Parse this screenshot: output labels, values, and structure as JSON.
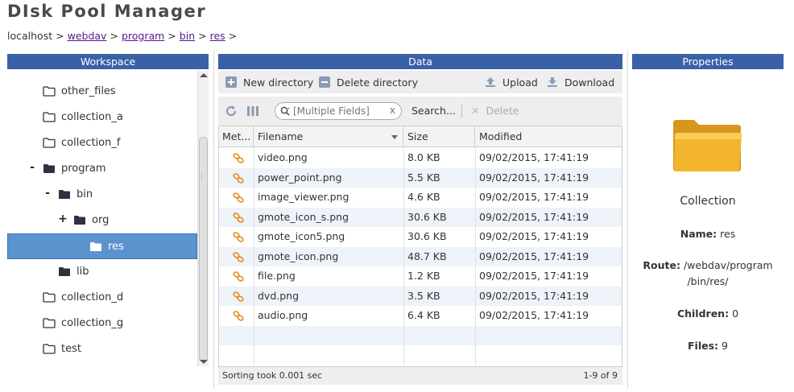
{
  "app": {
    "title": "DIsk Pool Manager"
  },
  "breadcrumb": {
    "root": "localhost",
    "links": [
      "webdav",
      "program",
      "bin",
      "res"
    ],
    "separator": ">"
  },
  "panels": {
    "workspace": "Workspace",
    "data": "Data",
    "properties": "Properties"
  },
  "tree": {
    "items": [
      {
        "label": "other_files",
        "toggle": "",
        "icon": "folder-outline-icon"
      },
      {
        "label": "collection_a",
        "toggle": "",
        "icon": "folder-outline-icon"
      },
      {
        "label": "collection_f",
        "toggle": "",
        "icon": "folder-outline-icon"
      },
      {
        "label": "program",
        "toggle": "-",
        "icon": "folder-filled-icon"
      },
      {
        "label": "bin",
        "toggle": "-",
        "icon": "folder-filled-icon"
      },
      {
        "label": "org",
        "toggle": "+",
        "icon": "folder-filled-icon"
      },
      {
        "label": "res",
        "toggle": "",
        "icon": "folder-white-icon",
        "selected": true
      },
      {
        "label": "lib",
        "toggle": "",
        "icon": "folder-filled-icon"
      },
      {
        "label": "collection_d",
        "toggle": "",
        "icon": "folder-outline-icon"
      },
      {
        "label": "collection_g",
        "toggle": "",
        "icon": "folder-outline-icon"
      },
      {
        "label": "test",
        "toggle": "",
        "icon": "folder-outline-icon"
      }
    ]
  },
  "toolbar": {
    "new_directory": "New directory",
    "delete_directory": "Delete directory",
    "upload": "Upload",
    "download": "Download"
  },
  "filter": {
    "placeholder": "[Multiple Fields]",
    "clear": "x",
    "search_label": "Search...",
    "delete_label": "Delete"
  },
  "grid": {
    "columns": [
      "Met...",
      "Filename",
      "Size",
      "Modified"
    ],
    "rows": [
      {
        "filename": "video.png",
        "size": "8.0 KB",
        "modified": "09/02/2015, 17:41:19"
      },
      {
        "filename": "power_point.png",
        "size": "5.5 KB",
        "modified": "09/02/2015, 17:41:19"
      },
      {
        "filename": "image_viewer.png",
        "size": "4.6 KB",
        "modified": "09/02/2015, 17:41:19"
      },
      {
        "filename": "gmote_icon_s.png",
        "size": "30.6 KB",
        "modified": "09/02/2015, 17:41:19"
      },
      {
        "filename": "gmote_icon5.png",
        "size": "30.6 KB",
        "modified": "09/02/2015, 17:41:19"
      },
      {
        "filename": "gmote_icon.png",
        "size": "48.7 KB",
        "modified": "09/02/2015, 17:41:19"
      },
      {
        "filename": "file.png",
        "size": "1.2 KB",
        "modified": "09/02/2015, 17:41:19"
      },
      {
        "filename": "dvd.png",
        "size": "3.5 KB",
        "modified": "09/02/2015, 17:41:19"
      },
      {
        "filename": "audio.png",
        "size": "6.4 KB",
        "modified": "09/02/2015, 17:41:19"
      }
    ],
    "footer_status": "Sorting took 0.001 sec",
    "footer_count": "1-9 of 9"
  },
  "properties": {
    "type": "Collection",
    "name_label": "Name:",
    "name_value": "res",
    "route_label": "Route:",
    "route_value_line1": "/webdav/program",
    "route_value_line2": "/bin/res/",
    "children_label": "Children:",
    "children_value": "0",
    "files_label": "Files:",
    "files_value": "9"
  },
  "colors": {
    "header_blue": "#3a60a8",
    "selection_blue": "#5b93cf",
    "folder_yellow": "#f3b52e",
    "link_orange": "#e8891a"
  }
}
